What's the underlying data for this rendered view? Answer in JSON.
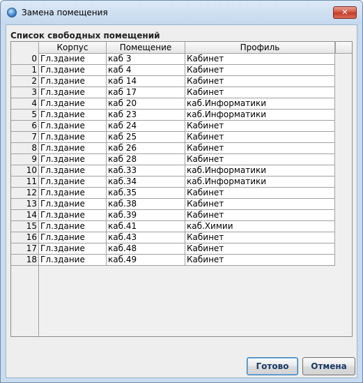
{
  "window": {
    "title": "Замена помещения",
    "close_glyph": "✕"
  },
  "section_label": "Список свободных помещений",
  "table": {
    "columns": [
      "Корпус",
      "Помещение",
      "Профиль"
    ],
    "rows": [
      {
        "num": "0",
        "building": "Гл.здание",
        "room": "каб 3",
        "profile": "Кабинет"
      },
      {
        "num": "1",
        "building": "Гл.здание",
        "room": "каб 4",
        "profile": "Кабинет"
      },
      {
        "num": "2",
        "building": "Гл.здание",
        "room": "каб 14",
        "profile": "Кабинет"
      },
      {
        "num": "3",
        "building": "Гл.здание",
        "room": "каб 17",
        "profile": "Кабинет"
      },
      {
        "num": "4",
        "building": "Гл.здание",
        "room": "каб 20",
        "profile": "каб.Информатики"
      },
      {
        "num": "5",
        "building": "Гл.здание",
        "room": "каб 23",
        "profile": "каб.Информатики"
      },
      {
        "num": "6",
        "building": "Гл.здание",
        "room": "каб 24",
        "profile": "Кабинет"
      },
      {
        "num": "7",
        "building": "Гл.здание",
        "room": "каб 25",
        "profile": "Кабинет"
      },
      {
        "num": "8",
        "building": "Гл.здание",
        "room": "каб 26",
        "profile": "Кабинет"
      },
      {
        "num": "9",
        "building": "Гл.здание",
        "room": "каб 28",
        "profile": "Кабинет"
      },
      {
        "num": "10",
        "building": "Гл.здание",
        "room": "каб.33",
        "profile": "каб.Информатики"
      },
      {
        "num": "11",
        "building": "Гл.здание",
        "room": "каб.34",
        "profile": "каб.Информатики"
      },
      {
        "num": "12",
        "building": "Гл.здание",
        "room": "каб.35",
        "profile": "Кабинет"
      },
      {
        "num": "13",
        "building": "Гл.здание",
        "room": "каб.38",
        "profile": "Кабинет"
      },
      {
        "num": "14",
        "building": "Гл.здание",
        "room": "каб.39",
        "profile": "Кабинет"
      },
      {
        "num": "15",
        "building": "Гл.здание",
        "room": "каб.41",
        "profile": "каб.Химии"
      },
      {
        "num": "16",
        "building": "Гл.здание",
        "room": "каб.43",
        "profile": "Кабинет"
      },
      {
        "num": "17",
        "building": "Гл.здание",
        "room": "каб.48",
        "profile": "Кабинет"
      },
      {
        "num": "18",
        "building": "Гл.здание",
        "room": "каб.49",
        "profile": "Кабинет"
      }
    ]
  },
  "buttons": {
    "ok": "Готово",
    "cancel": "Отмена"
  },
  "colors": {
    "title_bar": "#c4d8ee",
    "close_button": "#c23b26",
    "panel": "#eeeeee"
  }
}
